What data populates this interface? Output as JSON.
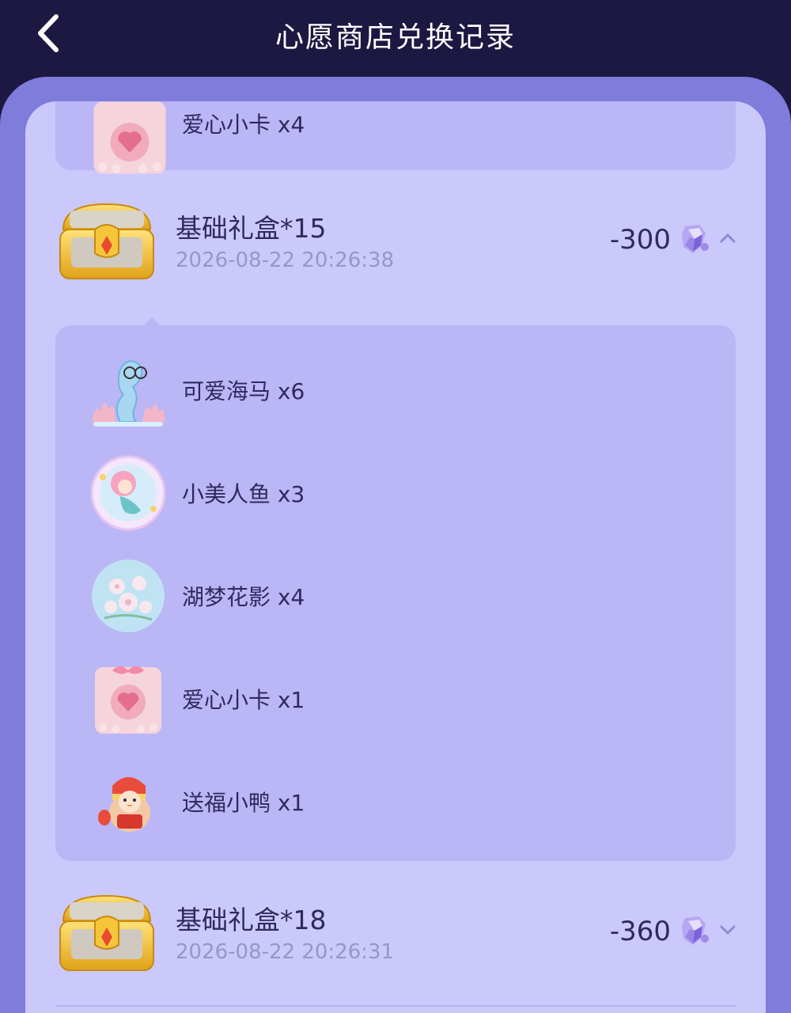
{
  "header": {
    "title": "心愿商店兑换记录"
  },
  "colors": {
    "header_bg": "#1c1842",
    "outer_panel": "#7f7cdc",
    "inner_panel": "#cbc8fb",
    "subcard": "#bbb6f5",
    "text_primary": "#2e2a5e",
    "text_secondary": "#9896c8"
  },
  "top_partial_item": {
    "name": "爱心小卡 x4",
    "icon": "heart-card-icon"
  },
  "records": [
    {
      "title": "基础礼盒*15",
      "time": "2026-08-22 20:26:38",
      "cost": "-300",
      "expanded": true,
      "items": [
        {
          "name": "可爱海马 x6",
          "icon": "seahorse-icon"
        },
        {
          "name": "小美人鱼 x3",
          "icon": "mermaid-icon"
        },
        {
          "name": "湖梦花影 x4",
          "icon": "flower-bubble-icon"
        },
        {
          "name": "爱心小卡 x1",
          "icon": "heart-card-icon"
        },
        {
          "name": "送福小鸭 x1",
          "icon": "lucky-duck-icon"
        }
      ]
    },
    {
      "title": "基础礼盒*18",
      "time": "2026-08-22 20:26:31",
      "cost": "-360",
      "expanded": false,
      "items": []
    }
  ]
}
